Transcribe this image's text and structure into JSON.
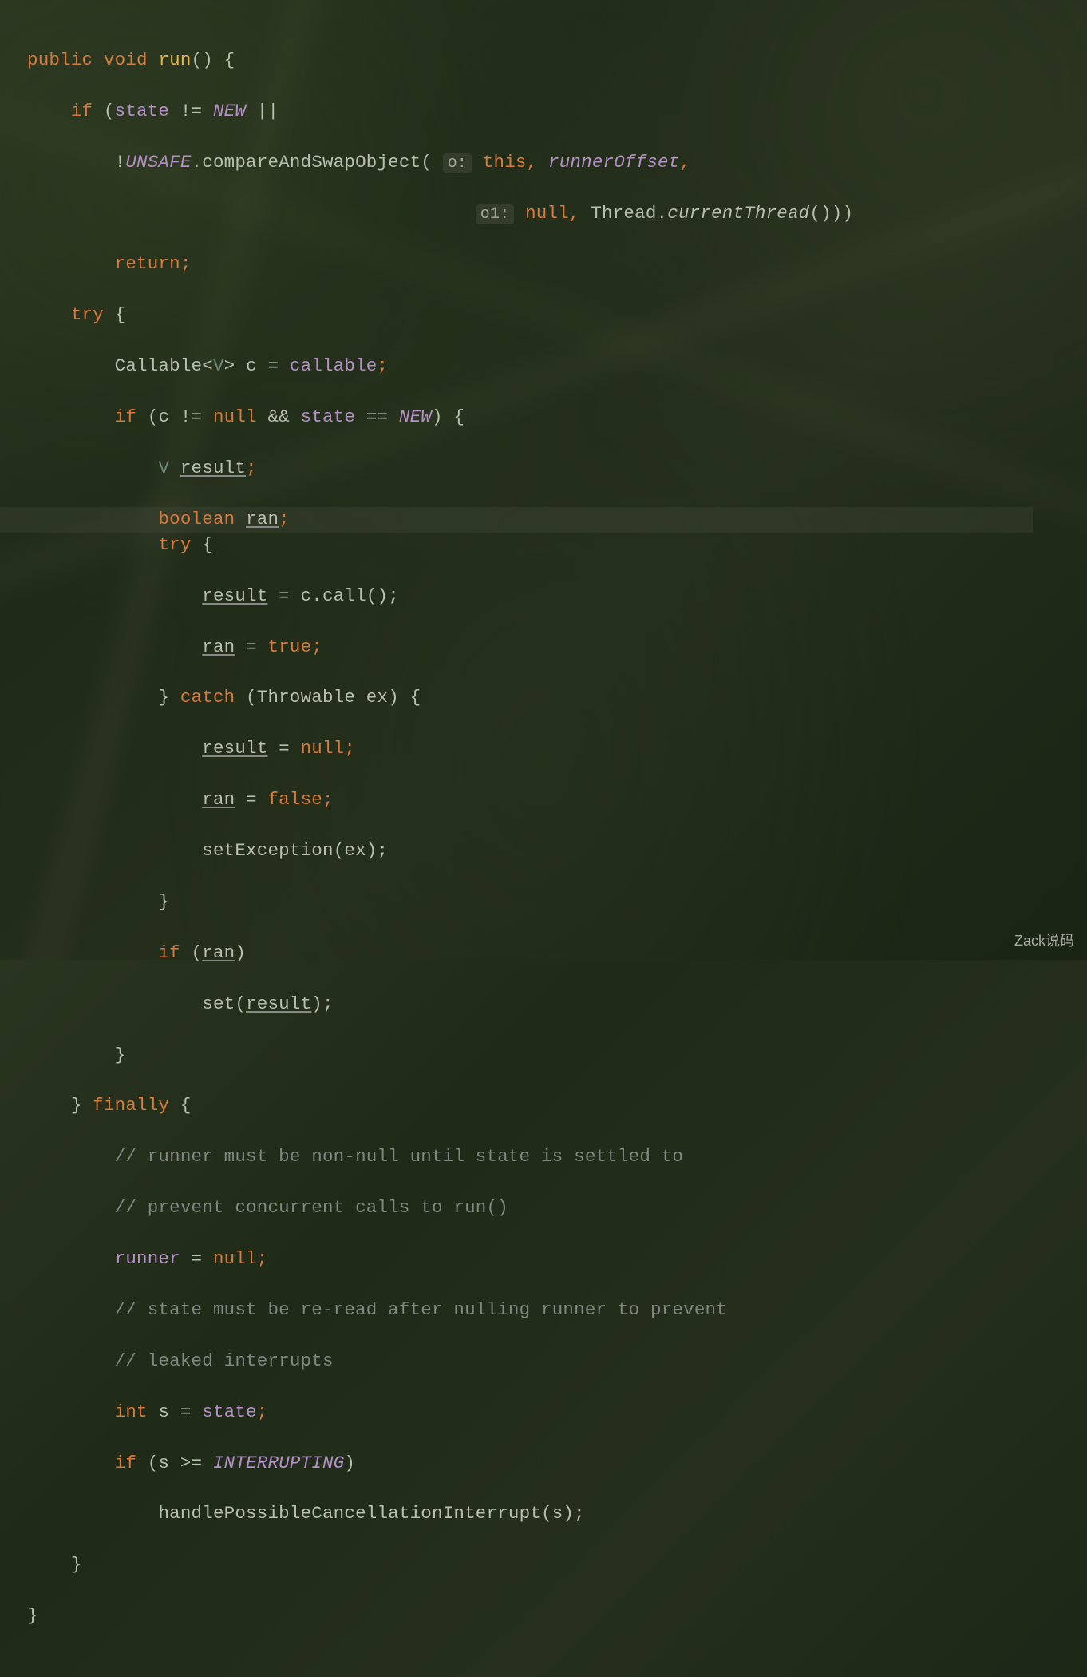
{
  "watermark": "Zack说码",
  "hints": {
    "o": "o:",
    "o1": "o1:"
  },
  "code": {
    "l1": {
      "public": "public",
      "void": "void",
      "run": "run",
      "p1": "()",
      "brace": " {"
    },
    "l2": {
      "indent": "    ",
      "if": "if",
      "p": " (",
      "state": "state",
      "neq": " != ",
      "NEW": "NEW",
      "or": " ||"
    },
    "l3": {
      "indent": "        ",
      "not": "!",
      "UNSAFE": "UNSAFE",
      "dot": ".",
      "method": "compareAndSwapObject",
      "p": "( ",
      "this": "this",
      "comma": ", ",
      "runnerOffset": "runnerOffset",
      "comma2": ","
    },
    "l4": {
      "indent": "                                         ",
      "null": "null",
      "comma": ", ",
      "thread": "Thread",
      "dot": ".",
      "ct": "currentThread",
      "end": "()))"
    },
    "l5": {
      "indent": "        ",
      "return": "return",
      "semi": ";"
    },
    "l6": {
      "indent": "    ",
      "try": "try",
      "brace": " {"
    },
    "l7": {
      "indent": "        ",
      "type": "Callable",
      "lt": "<",
      "V": "V",
      "gt": ">",
      "sp": " ",
      "c": "c",
      "eq": " = ",
      "callable": "callable",
      "semi": ";"
    },
    "l8": {
      "indent": "        ",
      "if": "if",
      "p": " (",
      "c": "c",
      "neq": " != ",
      "null": "null",
      "and": " && ",
      "state": "state",
      "eqeq": " == ",
      "NEW": "NEW",
      "end": ") {"
    },
    "l9": {
      "indent": "            ",
      "V": "V",
      "sp": " ",
      "result": "result",
      "semi": ";"
    },
    "l10": {
      "indent": "            ",
      "boolean": "boolean",
      "sp": " ",
      "ran": "ran",
      "semi": ";"
    },
    "l11": {
      "indent": "            ",
      "try": "try",
      "brace": " {"
    },
    "l12": {
      "indent": "                ",
      "result": "result",
      "eq": " = ",
      "c": "c",
      "dot": ".",
      "call": "call",
      "end": "();"
    },
    "l13": {
      "indent": "                ",
      "ran": "ran",
      "eq": " = ",
      "true": "true",
      "semi": ";"
    },
    "l14": {
      "indent": "            ",
      "brace": "}",
      "sp": " ",
      "catch": "catch",
      "p": " (",
      "type": "Throwable",
      "sp2": " ",
      "ex": "ex",
      "end": ") {"
    },
    "l15": {
      "indent": "                ",
      "result": "result",
      "eq": " = ",
      "null": "null",
      "semi": ";"
    },
    "l16": {
      "indent": "                ",
      "ran": "ran",
      "eq": " = ",
      "false": "false",
      "semi": ";"
    },
    "l17": {
      "indent": "                ",
      "method": "setException",
      "p": "(",
      "ex": "ex",
      "end": ");"
    },
    "l18": {
      "indent": "            ",
      "brace": "}"
    },
    "l19": {
      "indent": "            ",
      "if": "if",
      "p": " (",
      "ran": "ran",
      "end": ")"
    },
    "l20": {
      "indent": "                ",
      "set": "set",
      "p": "(",
      "result": "result",
      "end": ");"
    },
    "l21": {
      "indent": "        ",
      "brace": "}"
    },
    "l22": {
      "indent": "    ",
      "brace": "}",
      "sp": " ",
      "finally": "finally",
      "brace2": " {"
    },
    "l23": {
      "indent": "        ",
      "text": "// runner must be non-null until state is settled to"
    },
    "l24": {
      "indent": "        ",
      "text": "// prevent concurrent calls to run()"
    },
    "l25": {
      "indent": "        ",
      "runner": "runner",
      "eq": " = ",
      "null": "null",
      "semi": ";"
    },
    "l26": {
      "indent": "        ",
      "text": "// state must be re-read after nulling runner to prevent"
    },
    "l27": {
      "indent": "        ",
      "text": "// leaked interrupts"
    },
    "l28": {
      "indent": "        ",
      "int": "int",
      "sp": " ",
      "s": "s",
      "eq": " = ",
      "state": "state",
      "semi": ";"
    },
    "l29": {
      "indent": "        ",
      "if": "if",
      "p": " (",
      "s": "s",
      "gte": " >= ",
      "INTERRUPTING": "INTERRUPTING",
      "end": ")"
    },
    "l30": {
      "indent": "            ",
      "method": "handlePossibleCancellationInterrupt",
      "p": "(",
      "s": "s",
      "end": ");"
    },
    "l31": {
      "indent": "    ",
      "brace": "}"
    },
    "l32": {
      "brace": "}"
    }
  }
}
